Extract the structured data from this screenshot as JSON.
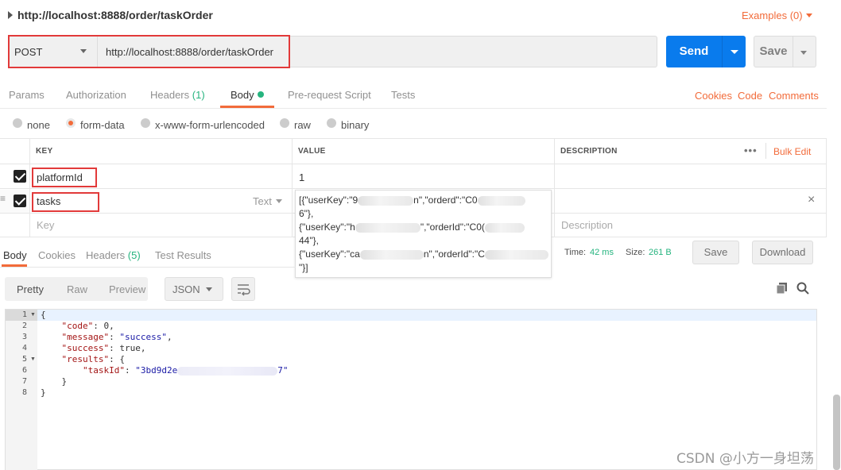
{
  "request": {
    "title": "http://localhost:8888/order/taskOrder",
    "examples_label": "Examples (0)",
    "method": "POST",
    "url": "http://localhost:8888/order/taskOrder",
    "send_label": "Send",
    "save_label": "Save"
  },
  "req_tabs": [
    {
      "label": "Params"
    },
    {
      "label": "Authorization"
    },
    {
      "label": "Headers",
      "count": "(1)"
    },
    {
      "label": "Body"
    },
    {
      "label": "Pre-request Script"
    },
    {
      "label": "Tests"
    }
  ],
  "right_links": [
    "Cookies",
    "Code",
    "Comments"
  ],
  "body_types": [
    "none",
    "form-data",
    "x-www-form-urlencoded",
    "raw",
    "binary"
  ],
  "selected_body_type": "form-data",
  "params_table": {
    "headers": [
      "KEY",
      "VALUE",
      "DESCRIPTION"
    ],
    "bulk_edit": "Bulk Edit",
    "rows": [
      {
        "key": "platformId",
        "value": "1"
      },
      {
        "key": "tasks",
        "type": "Text"
      }
    ],
    "key_placeholder": "Key",
    "description_placeholder": "Description"
  },
  "value_popup": {
    "line1_a": "[{\"userKey\":\"9",
    "line1_b": "n\",\"order",
    "line1_c": "d\":\"C0",
    "line2": "6\"},",
    "line3_a": "{\"userKey\":\"h",
    "line3_b": "\",\"orderId\":\"C0(",
    "line4": "44\"},",
    "line5_a": "{\"userKey\":\"ca",
    "line5_b": "n\",\"orderId\":\"C",
    "line6": "\"}]"
  },
  "response": {
    "tabs": [
      {
        "label": "Body"
      },
      {
        "label": "Cookies"
      },
      {
        "label": "Headers",
        "count": "(5)"
      },
      {
        "label": "Test Results"
      }
    ],
    "time_label": "Time:",
    "time_value": "42 ms",
    "size_label": "Size:",
    "size_value": "261 B",
    "save_label": "Save",
    "download_label": "Download",
    "formats": [
      "Pretty",
      "Raw",
      "Preview"
    ],
    "format_select": "JSON"
  },
  "code": {
    "line_numbers": [
      "1",
      "2",
      "3",
      "4",
      "5",
      "6",
      "7",
      "8"
    ],
    "l1": "{",
    "code_key": "\"code\"",
    "code_val": "0,",
    "message_key": "\"message\"",
    "message_val": "\"success\"",
    "success_key": "\"success\"",
    "success_val": "true,",
    "results_key": "\"results\"",
    "results_open": ": {",
    "taskid_key": "\"taskId\"",
    "taskid_val_a": "\"3bd9d2e",
    "taskid_val_b": "7\"",
    "l7": "}",
    "l8": "}"
  },
  "watermark": "CSDN @小方一身坦荡",
  "colors": {
    "accent": "#f26b3a",
    "send_blue": "#097bed",
    "green": "#26b47f",
    "highlight_red": "#e23a3a"
  }
}
